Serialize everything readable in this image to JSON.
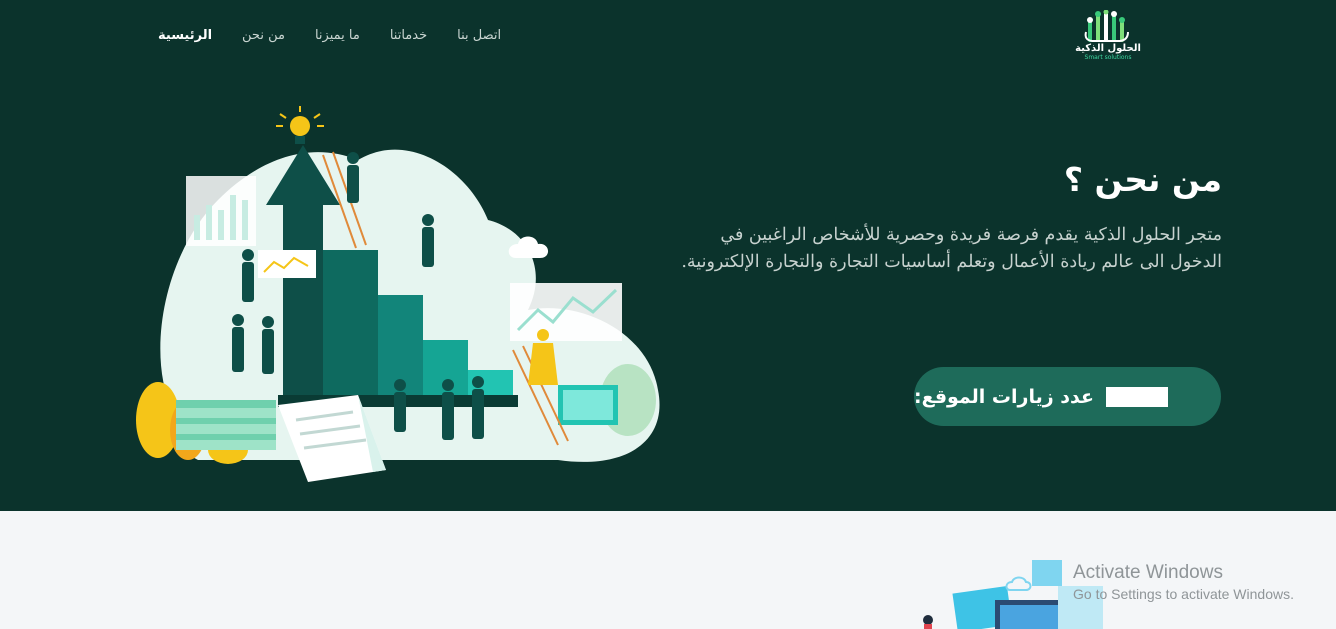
{
  "nav": {
    "items": [
      {
        "label": "الرئيسية",
        "active": true
      },
      {
        "label": "من نحن",
        "active": false
      },
      {
        "label": "ما يميزنا",
        "active": false
      },
      {
        "label": "خدماتنا",
        "active": false
      },
      {
        "label": "اتصل بنا",
        "active": false
      }
    ]
  },
  "logo": {
    "name_ar": "الحلول الذكية",
    "name_en": "Smart solutions",
    "icon": "circuit-hand-icon"
  },
  "about": {
    "title": "من نحن ؟",
    "description": "متجر الحلول الذكية يقدم فرصة فريدة وحصرية للأشخاص الراغبين في الدخول الى عالم ريادة الأعمال وتعلم أساسيات التجارة والتجارة الإلكترونية.",
    "visits_label": "عدد زيارات الموقع:"
  },
  "watermark": {
    "title": "Activate Windows",
    "subtitle": "Go to Settings to activate Windows."
  },
  "colors": {
    "hero_bg": "#0b332c",
    "button_bg": "#1e6b5a",
    "accent_teal": "#0e9e8e",
    "accent_yellow": "#f5c518"
  }
}
